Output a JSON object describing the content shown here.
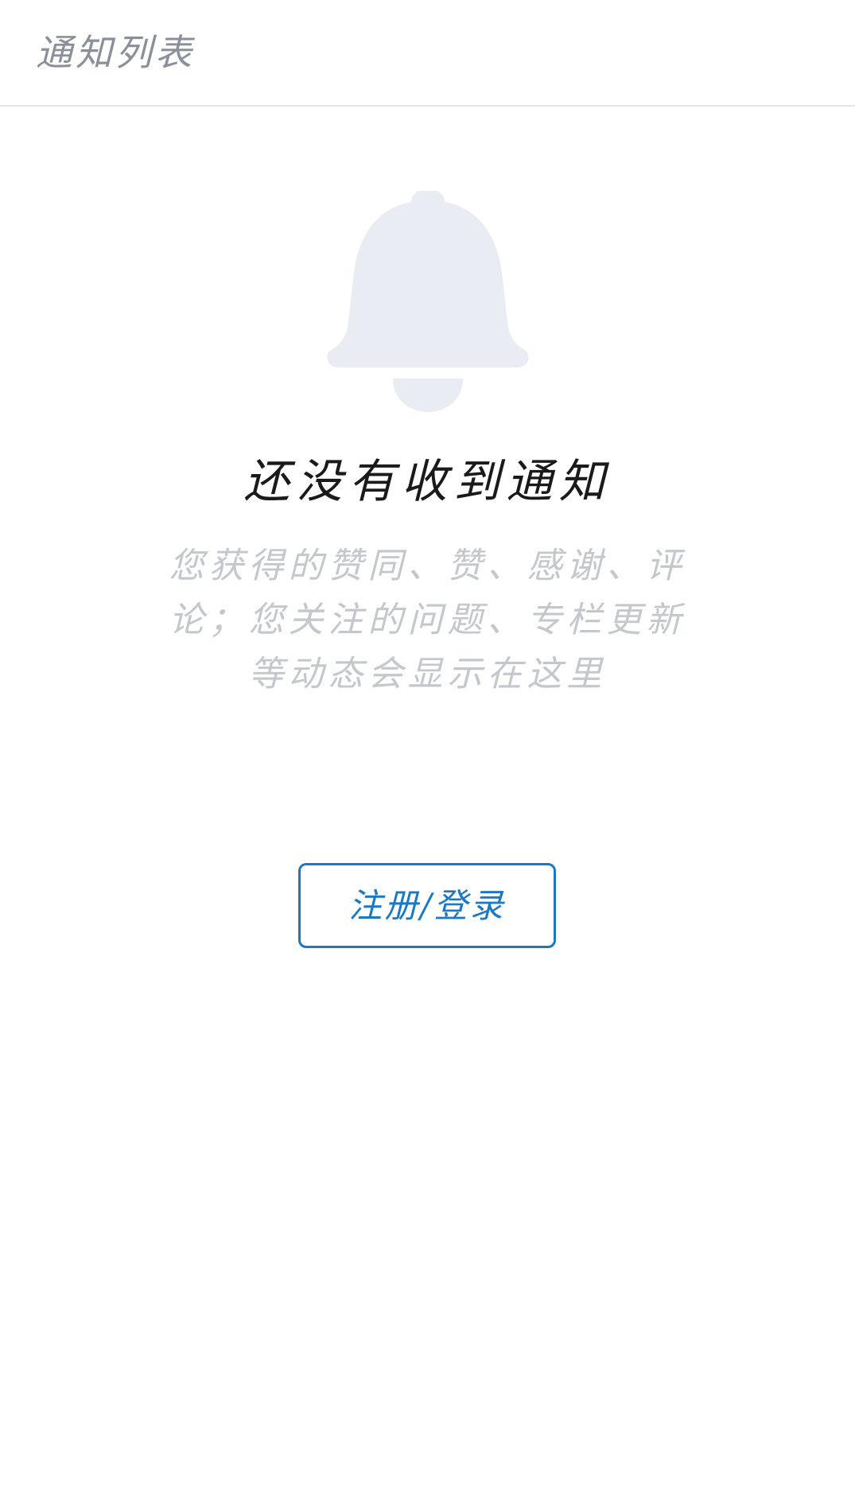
{
  "header": {
    "title": "通知列表"
  },
  "empty_state": {
    "icon": "bell-icon",
    "title": "还没有收到通知",
    "description": "您获得的赞同、赞、感谢、评论；您关注的问题、专栏更新等动态会显示在这里"
  },
  "auth_button": {
    "label": "注册/登录"
  },
  "colors": {
    "accent": "#1a78c9",
    "bell": "#e9ecf2",
    "title_text": "#1a1a1a",
    "muted_text": "#c4c7cc",
    "header_text": "#8a8f99"
  }
}
